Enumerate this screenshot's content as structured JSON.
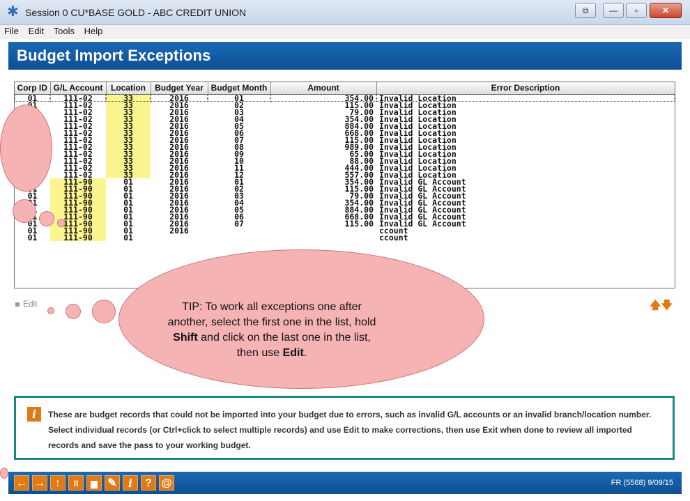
{
  "window": {
    "title": "Session 0 CU*BASE GOLD - ABC CREDIT UNION",
    "buttons": [
      "⧉",
      "—",
      "▫",
      "✕"
    ]
  },
  "menu": [
    "File",
    "Edit",
    "Tools",
    "Help"
  ],
  "page": {
    "title": "Budget Import Exceptions"
  },
  "grid": {
    "columns": [
      "Corp ID",
      "G/L Account",
      "Location",
      "Budget Year",
      "Budget Month",
      "Amount",
      "Error Description"
    ],
    "rows": [
      [
        "01",
        "111-02",
        "33",
        "2016",
        "01",
        "354.00",
        "Invalid Location"
      ],
      [
        "01",
        "111-02",
        "33",
        "2016",
        "02",
        "115.00",
        "Invalid Location"
      ],
      [
        "01",
        "111-02",
        "33",
        "2016",
        "03",
        "79.00",
        "Invalid Location"
      ],
      [
        "01",
        "111-02",
        "33",
        "2016",
        "04",
        "354.00",
        "Invalid Location"
      ],
      [
        "01",
        "111-02",
        "33",
        "2016",
        "05",
        "884.00",
        "Invalid Location"
      ],
      [
        "01",
        "111-02",
        "33",
        "2016",
        "06",
        "668.00",
        "Invalid Location"
      ],
      [
        "01",
        "111-02",
        "33",
        "2016",
        "07",
        "115.00",
        "Invalid Location"
      ],
      [
        "01",
        "111-02",
        "33",
        "2016",
        "08",
        "989.00",
        "Invalid Location"
      ],
      [
        "01",
        "111-02",
        "33",
        "2016",
        "09",
        "65.00",
        "Invalid Location"
      ],
      [
        "01",
        "111-02",
        "33",
        "2016",
        "10",
        "88.00",
        "Invalid Location"
      ],
      [
        "01",
        "111-02",
        "33",
        "2016",
        "11",
        "444.00",
        "Invalid Location"
      ],
      [
        "01",
        "111-02",
        "33",
        "2016",
        "12",
        "557.00",
        "Invalid Location"
      ],
      [
        "01",
        "111-90",
        "01",
        "2016",
        "01",
        "354.00",
        "Invalid GL Account"
      ],
      [
        "01",
        "111-90",
        "01",
        "2016",
        "02",
        "115.00",
        "Invalid GL Account"
      ],
      [
        "01",
        "111-90",
        "01",
        "2016",
        "03",
        "79.00",
        "Invalid GL Account"
      ],
      [
        "01",
        "111-90",
        "01",
        "2016",
        "04",
        "354.00",
        "Invalid GL Account"
      ],
      [
        "01",
        "111-90",
        "01",
        "2016",
        "05",
        "884.00",
        "Invalid GL Account"
      ],
      [
        "01",
        "111-90",
        "01",
        "2016",
        "06",
        "668.00",
        "Invalid GL Account"
      ],
      [
        "01",
        "111-90",
        "01",
        "2016",
        "07",
        "115.00",
        "Invalid GL Account"
      ],
      [
        "01",
        "111-90",
        "01",
        "2016",
        "",
        "",
        "ccount"
      ],
      [
        "01",
        "111-90",
        "01",
        "",
        "",
        "",
        "ccount"
      ]
    ]
  },
  "actions": {
    "edit": "Edit"
  },
  "nav_arrows": "🡅🡇",
  "tip": {
    "prefix": "TIP: To work all exceptions one after another, select the first one in the list, hold ",
    "key1": "Shift",
    "middle": " and click on the last one in the list, then use ",
    "key2": "Edit",
    "suffix": "."
  },
  "info": {
    "text": "These are budget records that could not be imported into your budget due to errors, such as invalid G/L accounts or an invalid branch/location number.  Select individual records (or Ctrl+click to select multiple records) and use Edit to make corrections, then use Exit when done to review all imported records and save the pass to your working budget."
  },
  "footer": {
    "buttons": [
      "←",
      "→",
      "↑",
      "II",
      "▆",
      "✎",
      "i",
      "?",
      "@"
    ],
    "code": "FR (5568) 9/09/15"
  },
  "colors": {
    "header_blue": "#1565b0",
    "highlight_yellow": "#fbf58f",
    "accent_orange": "#e07b14",
    "info_teal": "#1a8a86",
    "tip_cloud": "#f6b3b4"
  }
}
